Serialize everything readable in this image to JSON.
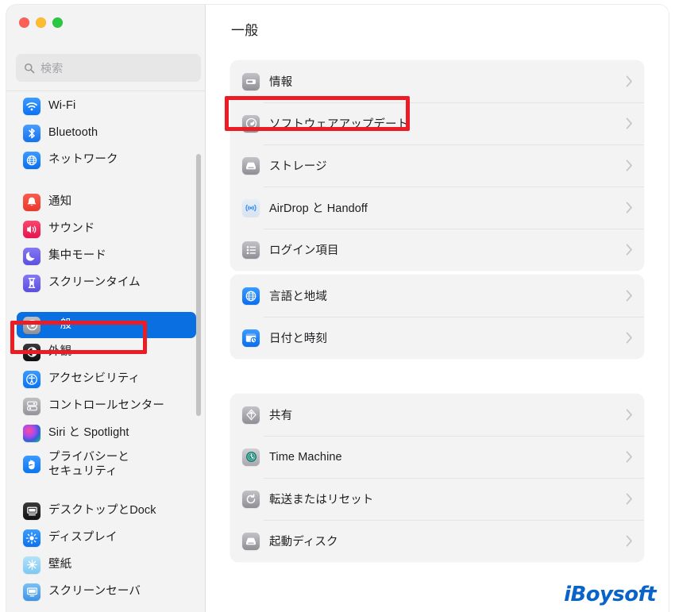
{
  "window": {
    "traffic_lights": [
      {
        "name": "close",
        "color": "#ff5f57"
      },
      {
        "name": "minimize",
        "color": "#febc2e"
      },
      {
        "name": "zoom",
        "color": "#28c840"
      }
    ]
  },
  "search": {
    "placeholder": "検索",
    "value": "",
    "icon": "search-icon"
  },
  "sidebar": {
    "scrollbar": true,
    "groups": [
      {
        "items": [
          {
            "label": "Wi-Fi",
            "icon": "wifi-icon",
            "color": "#1a84ff",
            "selected": false
          },
          {
            "label": "Bluetooth",
            "icon": "bluetooth-icon",
            "color": "#2f7ff0",
            "selected": false
          },
          {
            "label": "ネットワーク",
            "icon": "network-globe-icon",
            "color": "#1a84ff",
            "selected": false
          }
        ]
      },
      {
        "items": [
          {
            "label": "通知",
            "icon": "notifications-bell-icon",
            "color": "#f04439",
            "selected": false
          },
          {
            "label": "サウンド",
            "icon": "sound-speaker-icon",
            "color": "#f2295b",
            "selected": false
          },
          {
            "label": "集中モード",
            "icon": "focus-moon-icon",
            "color": "#6f61e8",
            "selected": false
          },
          {
            "label": "スクリーンタイム",
            "icon": "screen-time-hourglass-icon",
            "color": "#6f61e8",
            "selected": false
          }
        ]
      },
      {
        "items": [
          {
            "label": "一般",
            "icon": "general-gear-icon",
            "color": "#9a9a9f",
            "selected": true
          },
          {
            "label": "外観",
            "icon": "appearance-icon",
            "color": "#1d1d1f",
            "selected": false
          },
          {
            "label": "アクセシビリティ",
            "icon": "accessibility-icon",
            "color": "#1a84ff",
            "selected": false
          },
          {
            "label": "コントロールセンター",
            "icon": "control-center-icon",
            "color": "#9a9a9f",
            "selected": false
          },
          {
            "label": "Siri と Spotlight",
            "icon": "siri-icon",
            "color": "#2b2b33",
            "selected": false
          },
          {
            "label": "プライバシーと\nセキュリティ",
            "icon": "privacy-hand-icon",
            "color": "#1a84ff",
            "selected": false
          }
        ]
      },
      {
        "items": [
          {
            "label": "デスクトップとDock",
            "icon": "desktop-dock-icon",
            "color": "#1d1d1f",
            "selected": false
          },
          {
            "label": "ディスプレイ",
            "icon": "display-brightness-icon",
            "color": "#1a84ff",
            "selected": false
          },
          {
            "label": "壁紙",
            "icon": "wallpaper-icon",
            "color": "#8fd3f8",
            "selected": false
          },
          {
            "label": "スクリーンセーバ",
            "icon": "screensaver-icon",
            "color": "#5aa9ee",
            "selected": false
          }
        ]
      }
    ]
  },
  "main": {
    "title": "一般",
    "cards": [
      {
        "rows": [
          {
            "label": "情報",
            "icon": "about-mac-icon",
            "chevron": "chevron-right-icon"
          },
          {
            "label": "ソフトウェアアップデート",
            "icon": "software-update-icon",
            "chevron": "chevron-right-icon"
          },
          {
            "label": "ストレージ",
            "icon": "storage-disk-icon",
            "chevron": "chevron-right-icon"
          },
          {
            "label": "AirDrop と Handoff",
            "icon": "airdrop-icon",
            "chevron": "chevron-right-icon"
          },
          {
            "label": "ログイン項目",
            "icon": "login-items-icon",
            "chevron": "chevron-right-icon"
          }
        ]
      },
      {
        "rows": [
          {
            "label": "言語と地域",
            "icon": "language-region-icon",
            "chevron": "chevron-right-icon"
          },
          {
            "label": "日付と時刻",
            "icon": "date-time-icon",
            "chevron": "chevron-right-icon"
          }
        ]
      },
      {
        "rows": [
          {
            "label": "共有",
            "icon": "sharing-icon",
            "chevron": "chevron-right-icon"
          },
          {
            "label": "Time Machine",
            "icon": "time-machine-icon",
            "chevron": "chevron-right-icon"
          },
          {
            "label": "転送またはリセット",
            "icon": "transfer-reset-icon",
            "chevron": "chevron-right-icon"
          },
          {
            "label": "起動ディスク",
            "icon": "startup-disk-icon",
            "chevron": "chevron-right-icon"
          }
        ]
      }
    ]
  },
  "watermark": {
    "text": "iBoysoft",
    "color": "#0a63c9"
  },
  "annotations": [
    {
      "name": "software-update-highlight",
      "color": "#ec1c24"
    },
    {
      "name": "general-sidebar-highlight",
      "color": "#ec1c24"
    }
  ]
}
